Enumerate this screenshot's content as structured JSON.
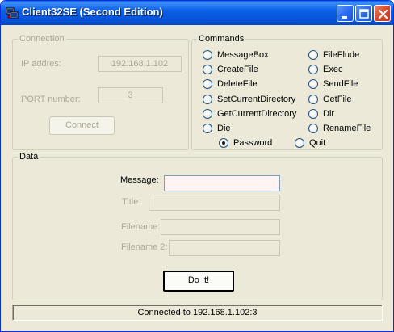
{
  "window": {
    "title": "Client32SE (Second Edition)"
  },
  "connection": {
    "group_title": "Connection",
    "ip_label": "IP addres:",
    "ip_value": "192.168.1.102",
    "port_label": "PORT number:",
    "port_value": "3",
    "connect_label": "Connect"
  },
  "commands": {
    "group_title": "Commands",
    "left": [
      "MessageBox",
      "CreateFile",
      "DeleteFile",
      "SetCurrentDirectory",
      "GetCurrentDirectory",
      "Die"
    ],
    "right": [
      "FileFlude",
      "Exec",
      "SendFile",
      "GetFile",
      "Dir",
      "RenameFile"
    ],
    "password": "Password",
    "quit": "Quit",
    "selected": "Password"
  },
  "data": {
    "group_title": "Data",
    "message_label": "Message:",
    "message_value": "",
    "title_label": "Title:",
    "title_value": "",
    "filename_label": "Filename:",
    "filename_value": "",
    "filename2_label": "Filename 2:",
    "filename2_value": "",
    "doit_label": "Do It!"
  },
  "status": {
    "text": "Connected to 192.168.1.102:3"
  },
  "icons": {
    "app": "app-icon",
    "minimize": "minimize-icon",
    "maximize": "maximize-icon",
    "close": "close-icon"
  },
  "colors": {
    "titlebar": "#0b5fe8",
    "face": "#ece9d8",
    "close_button": "#d84a2a",
    "disabled_text": "#aca899"
  }
}
